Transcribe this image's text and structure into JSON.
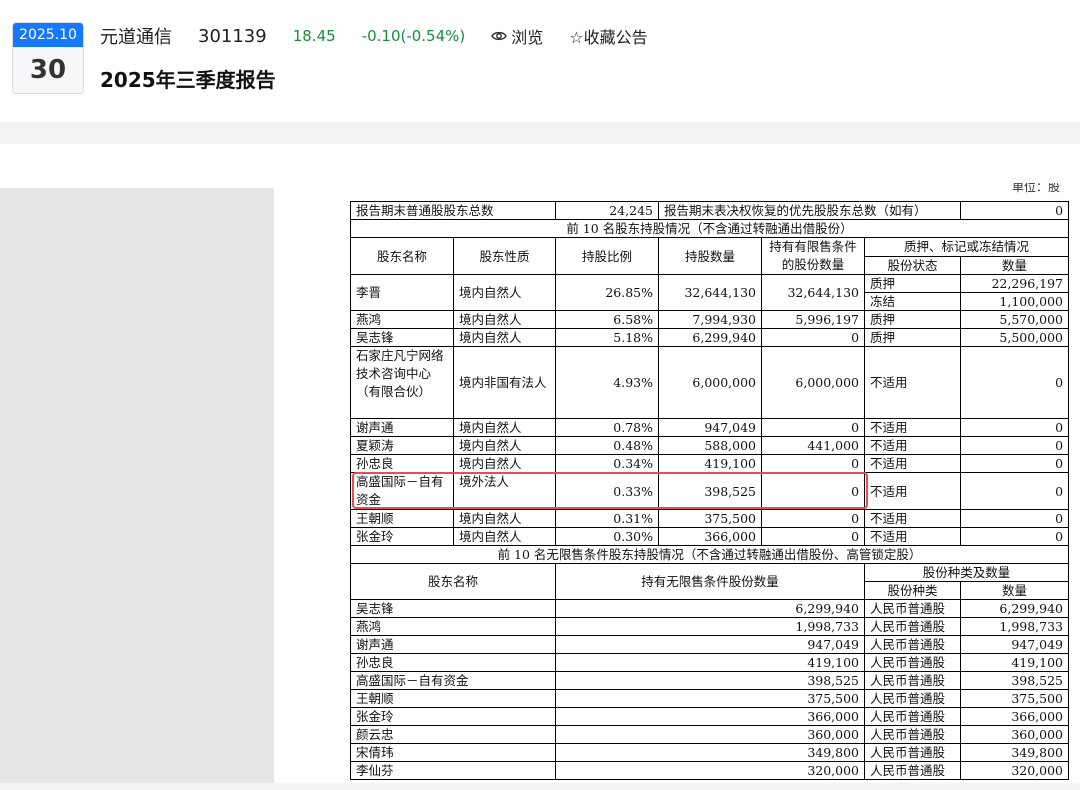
{
  "header": {
    "date_ym": "2025.10",
    "date_day": "30",
    "stock_name": "元道通信",
    "stock_code": "301139",
    "price": "18.45",
    "change": "-0.10(-0.54%)",
    "browse_label": "浏览",
    "favorite_label": "☆收藏公告",
    "report_title": "2025年三季度报告"
  },
  "doc": {
    "unit_note": "单位：股",
    "summary": {
      "common_holders_label": "报告期末普通股股东总数",
      "common_holders_value": "24,245",
      "preferred_label": "报告期末表决权恢复的优先股股东总数（如有）",
      "preferred_value": "0"
    },
    "top10_title": "前 10 名股东持股情况（不含通过转融通出借股份）",
    "top10_headers": {
      "name": "股东名称",
      "nature": "股东性质",
      "ratio": "持股比例",
      "qty": "持股数量",
      "restricted": "持有有限售条件的股份数量",
      "pledge_group": "质押、标记或冻结情况",
      "pledge_status": "股份状态",
      "pledge_qty": "数量"
    },
    "top10_rows": [
      {
        "name": "李晋",
        "nature": "境内自然人",
        "ratio": "26.85%",
        "qty": "32,644,130",
        "restricted": "32,644,130",
        "s1": "质押",
        "q1": "22,296,197",
        "s2": "冻结",
        "q2": "1,100,000"
      },
      {
        "name": "燕鸿",
        "nature": "境内自然人",
        "ratio": "6.58%",
        "qty": "7,994,930",
        "restricted": "5,996,197",
        "s1": "质押",
        "q1": "5,570,000"
      },
      {
        "name": "吴志锋",
        "nature": "境内自然人",
        "ratio": "5.18%",
        "qty": "6,299,940",
        "restricted": "0",
        "s1": "质押",
        "q1": "5,500,000"
      },
      {
        "name": "石家庄凡宁网络技术咨询中心（有限合伙）",
        "nature": "境内非国有法人",
        "ratio": "4.93%",
        "qty": "6,000,000",
        "restricted": "6,000,000",
        "s1": "不适用",
        "q1": "0"
      },
      {
        "name": "谢声通",
        "nature": "境内自然人",
        "ratio": "0.78%",
        "qty": "947,049",
        "restricted": "0",
        "s1": "不适用",
        "q1": "0"
      },
      {
        "name": "夏颖涛",
        "nature": "境内自然人",
        "ratio": "0.48%",
        "qty": "588,000",
        "restricted": "441,000",
        "s1": "不适用",
        "q1": "0"
      },
      {
        "name": "孙忠良",
        "nature": "境内自然人",
        "ratio": "0.34%",
        "qty": "419,100",
        "restricted": "0",
        "s1": "不适用",
        "q1": "0"
      },
      {
        "name": "高盛国际－自有资金",
        "nature": "境外法人",
        "ratio": "0.33%",
        "qty": "398,525",
        "restricted": "0",
        "s1": "不适用",
        "q1": "0"
      },
      {
        "name": "王朝顺",
        "nature": "境内自然人",
        "ratio": "0.31%",
        "qty": "375,500",
        "restricted": "0",
        "s1": "不适用",
        "q1": "0"
      },
      {
        "name": "张金玲",
        "nature": "境内自然人",
        "ratio": "0.30%",
        "qty": "366,000",
        "restricted": "0",
        "s1": "不适用",
        "q1": "0"
      }
    ],
    "unrestricted_title": "前 10 名无限售条件股东持股情况（不含通过转融通出借股份、高管锁定股）",
    "unrestricted_headers": {
      "name": "股东名称",
      "qty": "持有无限售条件股份数量",
      "type_group": "股份种类及数量",
      "type": "股份种类",
      "type_qty": "数量"
    },
    "unrestricted_rows": [
      {
        "name": "吴志锋",
        "qty": "6,299,940",
        "type": "人民币普通股",
        "type_qty": "6,299,940"
      },
      {
        "name": "燕鸿",
        "qty": "1,998,733",
        "type": "人民币普通股",
        "type_qty": "1,998,733"
      },
      {
        "name": "谢声通",
        "qty": "947,049",
        "type": "人民币普通股",
        "type_qty": "947,049"
      },
      {
        "name": "孙忠良",
        "qty": "419,100",
        "type": "人民币普通股",
        "type_qty": "419,100"
      },
      {
        "name": "高盛国际－自有资金",
        "qty": "398,525",
        "type": "人民币普通股",
        "type_qty": "398,525"
      },
      {
        "name": "王朝顺",
        "qty": "375,500",
        "type": "人民币普通股",
        "type_qty": "375,500"
      },
      {
        "name": "张金玲",
        "qty": "366,000",
        "type": "人民币普通股",
        "type_qty": "366,000"
      },
      {
        "name": "颜云忠",
        "qty": "360,000",
        "type": "人民币普通股",
        "type_qty": "360,000"
      },
      {
        "name": "宋倩玮",
        "qty": "349,800",
        "type": "人民币普通股",
        "type_qty": "349,800"
      },
      {
        "name": "李仙芬",
        "qty": "320,000",
        "type": "人民币普通股",
        "type_qty": "320,000"
      }
    ]
  },
  "colors": {
    "accent": "#1677ff",
    "price_green": "#1a8a3d",
    "highlight_red": "#ef4a52"
  },
  "icons": [
    "eye-icon"
  ]
}
